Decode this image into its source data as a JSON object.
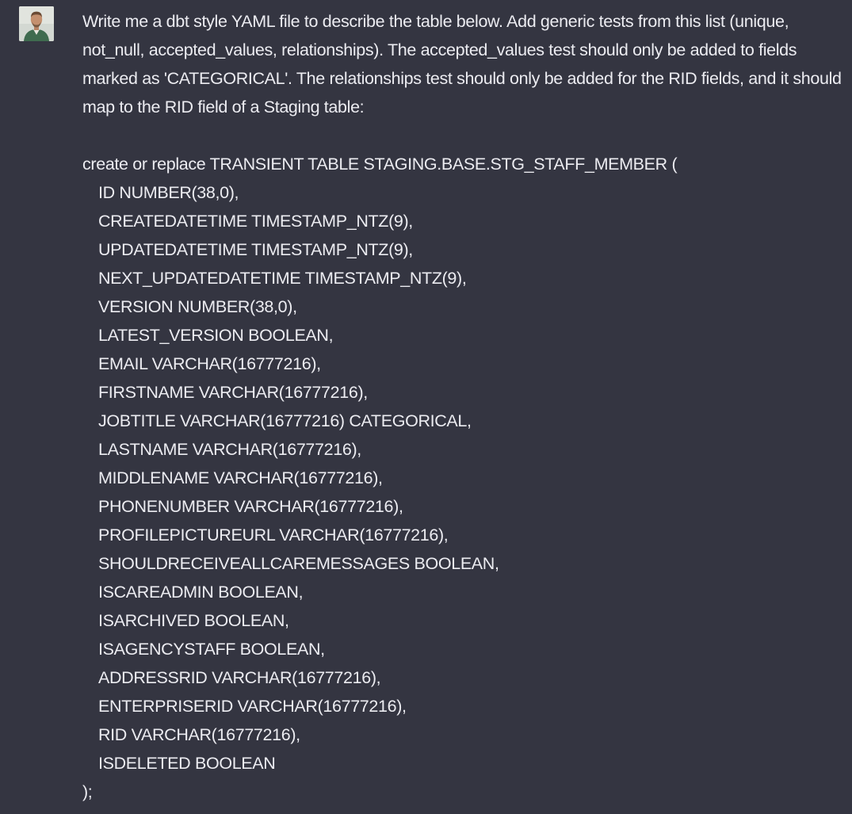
{
  "message": {
    "prompt": "Write me a dbt style YAML file to describe the table below. Add generic tests from this list (unique, not_null, accepted_values, relationships). The accepted_values test should only be added to fields marked as 'CATEGORICAL'. The relationships test should only be added for the RID fields, and it should map to the RID field of a Staging table:",
    "sql_open": "create or replace TRANSIENT TABLE STAGING.BASE.STG_STAFF_MEMBER (",
    "columns": [
      "ID NUMBER(38,0),",
      "CREATEDATETIME TIMESTAMP_NTZ(9),",
      "UPDATEDATETIME TIMESTAMP_NTZ(9),",
      "NEXT_UPDATEDATETIME TIMESTAMP_NTZ(9),",
      "VERSION NUMBER(38,0),",
      "LATEST_VERSION BOOLEAN,",
      "EMAIL VARCHAR(16777216),",
      "FIRSTNAME VARCHAR(16777216),",
      "JOBTITLE VARCHAR(16777216) CATEGORICAL,",
      "LASTNAME VARCHAR(16777216),",
      "MIDDLENAME VARCHAR(16777216),",
      "PHONENUMBER VARCHAR(16777216),",
      "PROFILEPICTUREURL VARCHAR(16777216),",
      "SHOULDRECEIVEALLCAREMESSAGES BOOLEAN,",
      "ISCAREADMIN BOOLEAN,",
      "ISARCHIVED BOOLEAN,",
      "ISAGENCYSTAFF BOOLEAN,",
      "ADDRESSRID VARCHAR(16777216),",
      "ENTERPRISERID VARCHAR(16777216),",
      "RID VARCHAR(16777216),",
      "ISDELETED BOOLEAN"
    ],
    "sql_close": ");"
  },
  "avatar": {
    "icon": "user-avatar-icon"
  },
  "colors": {
    "background": "#343541",
    "text": "#ececf1"
  }
}
